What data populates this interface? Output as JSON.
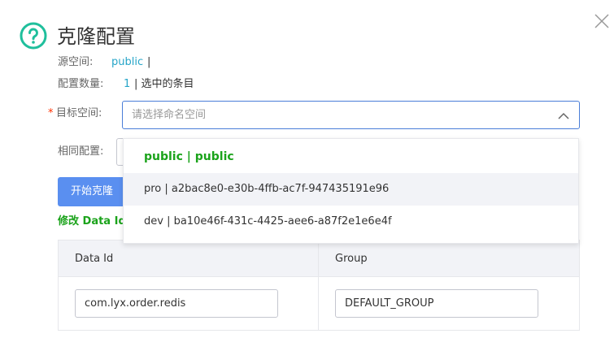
{
  "dialog": {
    "title": "克隆配置",
    "source_namespace_label": "源空间:",
    "source_namespace_value": "public",
    "source_namespace_separator": "|",
    "config_count_label": "配置数量:",
    "config_count_value": "1",
    "config_count_suffix": "| 选中的条目",
    "target_namespace_label": "目标空间:",
    "required_mark": "*",
    "target_namespace_placeholder": "请选择命名空间",
    "same_config_label": "相同配置:",
    "start_clone_label": "开始克隆",
    "modify_label": "修改 Data Id 和 Group",
    "table": {
      "headers": [
        "Data Id",
        "Group"
      ],
      "rows": [
        {
          "data_id": "com.lyx.order.redis",
          "group": "DEFAULT_GROUP"
        }
      ]
    },
    "dropdown_options": [
      {
        "label": "public | public"
      },
      {
        "label": "pro | a2bac8e0-e30b-4ffb-ac7f-947435191e96"
      },
      {
        "label": "dev | ba10e46f-431c-4425-aee6-a87f2e1e6e4f"
      }
    ]
  },
  "colors": {
    "accent": "#26a5c8",
    "primary_button": "#5a8ff0",
    "selected_option": "#1ba31b",
    "required": "#ff3000"
  },
  "icons": {
    "help": "question-circle-icon",
    "close": "close-icon",
    "arrow": "chevron-up-icon"
  }
}
